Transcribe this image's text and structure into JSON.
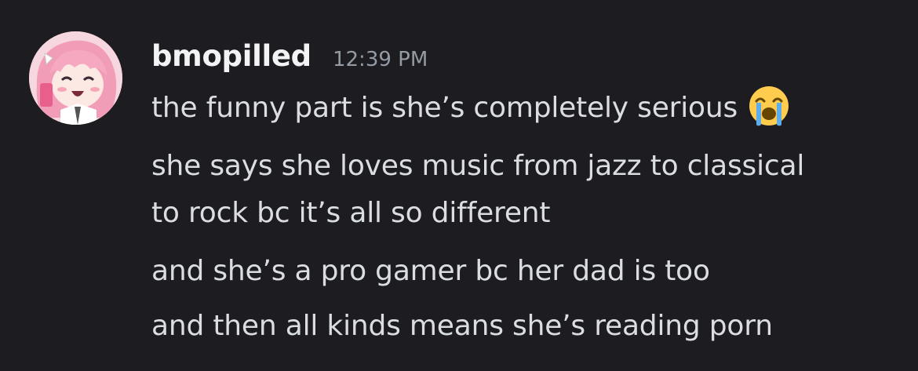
{
  "message": {
    "username": "bmopilled",
    "timestamp": "12:39 PM",
    "avatar_icon": "anime-girl-avatar-icon",
    "lines": [
      "the funny part is she’s completely serious",
      "she says she loves music from jazz to classical",
      "to rock bc it’s all so different",
      "and she’s a pro gamer bc her dad is too",
      "and then all kinds means she’s reading porn"
    ],
    "emoji": "loudly-crying-face-emoji"
  },
  "colors": {
    "background": "#1c1c21",
    "username": "#f2f3f5",
    "timestamp": "#949ba4",
    "message_text": "#dbdee1"
  }
}
